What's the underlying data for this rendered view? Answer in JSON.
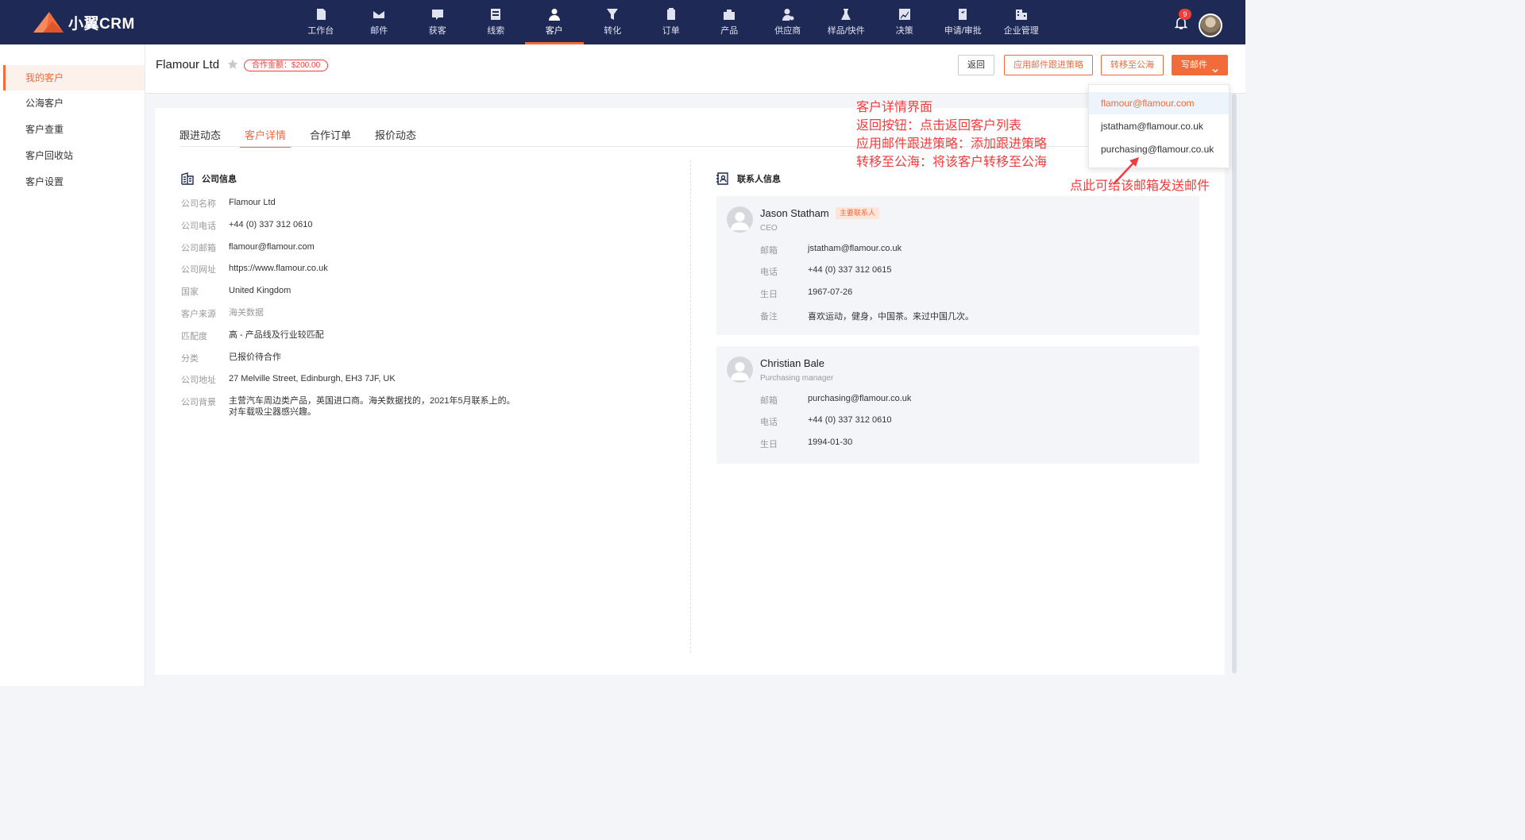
{
  "app": {
    "name": "小翼CRM"
  },
  "nav": [
    {
      "label": "工作台",
      "icon": "dashboard-icon"
    },
    {
      "label": "邮件",
      "icon": "mail-icon"
    },
    {
      "label": "获客",
      "icon": "acquire-icon"
    },
    {
      "label": "线索",
      "icon": "leads-icon"
    },
    {
      "label": "客户",
      "icon": "customer-icon",
      "active": true
    },
    {
      "label": "转化",
      "icon": "funnel-icon"
    },
    {
      "label": "订单",
      "icon": "order-icon"
    },
    {
      "label": "产品",
      "icon": "product-icon"
    },
    {
      "label": "供应商",
      "icon": "supplier-icon"
    },
    {
      "label": "样品/快件",
      "icon": "sample-icon"
    },
    {
      "label": "决策",
      "icon": "chart-icon"
    },
    {
      "label": "申请/审批",
      "icon": "approval-icon"
    },
    {
      "label": "企业管理",
      "icon": "company-icon"
    }
  ],
  "notifications": {
    "count": "9"
  },
  "sidebar": {
    "items": [
      {
        "label": "我的客户",
        "active": true
      },
      {
        "label": "公海客户"
      },
      {
        "label": "客户查重"
      },
      {
        "label": "客户回收站"
      },
      {
        "label": "客户设置"
      }
    ]
  },
  "header": {
    "customer_name": "Flamour Ltd",
    "deal_amount": "合作金额：$200.00",
    "buttons": {
      "back": "返回",
      "strategy": "应用邮件跟进策略",
      "transfer": "转移至公海",
      "mail": "写邮件"
    }
  },
  "tabs": [
    {
      "label": "跟进动态"
    },
    {
      "label": "客户详情",
      "active": true
    },
    {
      "label": "合作订单"
    },
    {
      "label": "报价动态"
    }
  ],
  "company": {
    "title": "公司信息",
    "fields": [
      {
        "k": "公司名称",
        "v": "Flamour Ltd"
      },
      {
        "k": "公司电话",
        "v": "+44 (0) 337 312 0610"
      },
      {
        "k": "公司邮箱",
        "v": "flamour@flamour.com"
      },
      {
        "k": "公司网址",
        "v": "https://www.flamour.co.uk"
      },
      {
        "k": "国家",
        "v": "United Kingdom"
      },
      {
        "k": "客户来源",
        "v": "海关数据"
      },
      {
        "k": "匹配度",
        "v": "高 - 产品线及行业较匹配"
      },
      {
        "k": "分类",
        "v": "已报价待合作"
      },
      {
        "k": "公司地址",
        "v": "27 Melville Street, Edinburgh, EH3 7JF, UK"
      },
      {
        "k": "公司背景",
        "v": "主营汽车周边类产品，英国进口商。海关数据找的，2021年5月联系上的。",
        "v2": "对车载吸尘器感兴趣。"
      }
    ]
  },
  "contacts": {
    "title": "联系人信息",
    "list": [
      {
        "name": "Jason Statham",
        "tag": "主要联系人",
        "title": "CEO",
        "fields": [
          {
            "k": "邮箱",
            "v": "jstatham@flamour.co.uk"
          },
          {
            "k": "电话",
            "v": "+44 (0) 337 312 0615"
          },
          {
            "k": "生日",
            "v": "1967-07-26"
          },
          {
            "k": "备注",
            "v": "喜欢运动，健身，中国茶。来过中国几次。"
          }
        ]
      },
      {
        "name": "Christian Bale",
        "title": "Purchasing manager",
        "fields": [
          {
            "k": "邮箱",
            "v": "purchasing@flamour.co.uk"
          },
          {
            "k": "电话",
            "v": "+44 (0) 337 312 0610"
          },
          {
            "k": "生日",
            "v": "1994-01-30"
          }
        ]
      }
    ]
  },
  "mail_dropdown": [
    "flamour@flamour.com",
    "jstatham@flamour.co.uk",
    "purchasing@flamour.co.uk"
  ],
  "annotations": {
    "lines": [
      "客户详情界面",
      "返回按钮：点击返回客户列表",
      "应用邮件跟进策略：添加跟进策略",
      "转移至公海：将该客户转移至公海"
    ],
    "dropdown_note": "点此可给该邮箱发送邮件"
  },
  "colors": {
    "accent": "#f26b3a",
    "navbar": "#1e2a55",
    "annotation": "#f23c3c"
  }
}
